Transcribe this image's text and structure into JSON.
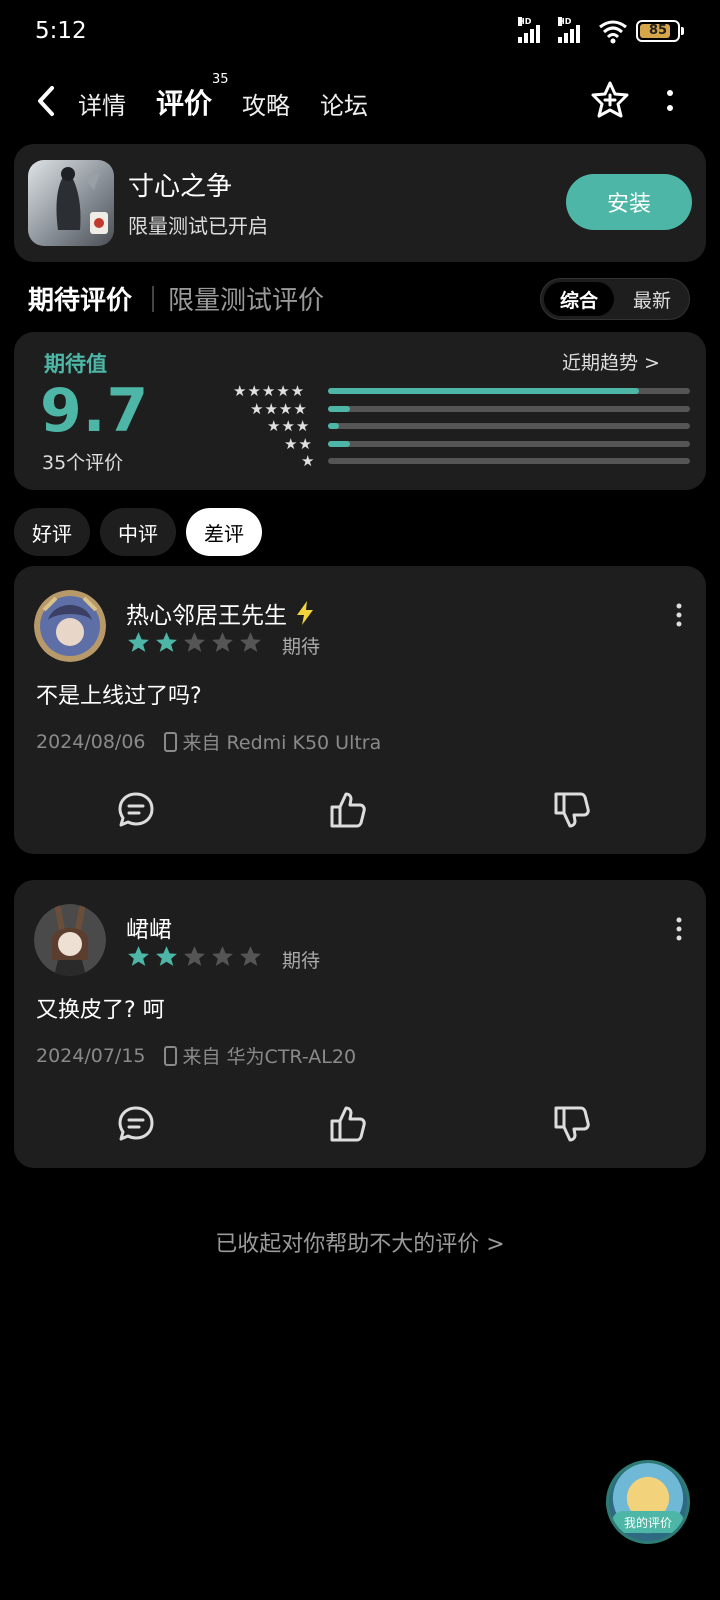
{
  "status_bar": {
    "time": "5:12",
    "battery": "85",
    "signal_badge": "HD"
  },
  "nav": {
    "tabs": [
      {
        "label": "详情"
      },
      {
        "label": "评价",
        "count": "35"
      },
      {
        "label": "攻略"
      },
      {
        "label": "论坛"
      }
    ],
    "active_tab": 1
  },
  "app": {
    "name": "寸心之争",
    "subtitle": "限量测试已开启",
    "install_label": "安装"
  },
  "section": {
    "title": "期待评价",
    "alt_title": "限量测试评价",
    "sort_options": [
      "综合",
      "最新"
    ],
    "selected_sort": 0
  },
  "rating": {
    "label": "期待值",
    "score": "9.7",
    "count_text": "35个评价",
    "trend_label": "近期趋势 >",
    "distribution": [
      {
        "stars": 5,
        "fraction": 0.86
      },
      {
        "stars": 4,
        "fraction": 0.06
      },
      {
        "stars": 3,
        "fraction": 0.03
      },
      {
        "stars": 2,
        "fraction": 0.06
      },
      {
        "stars": 1,
        "fraction": 0.0
      }
    ]
  },
  "filters": [
    "好评",
    "中评",
    "差评"
  ],
  "selected_filter": 2,
  "reviews": [
    {
      "user": "热心邻居王先生",
      "verified": true,
      "stars": 2,
      "tag": "期待",
      "text": "不是上线过了吗?",
      "date": "2024/08/06",
      "device": "来自 Redmi K50 Ultra"
    },
    {
      "user": "峮峮",
      "verified": false,
      "stars": 2,
      "tag": "期待",
      "text": "又换皮了? 呵",
      "date": "2024/07/15",
      "device": "来自 华为CTR-AL20"
    }
  ],
  "collapsed_text": "已收起对你帮助不大的评价 >",
  "my_review_label": "我的评价",
  "colors": {
    "accent": "#4db6a6",
    "card": "#1e1e1e",
    "background": "#000000"
  }
}
